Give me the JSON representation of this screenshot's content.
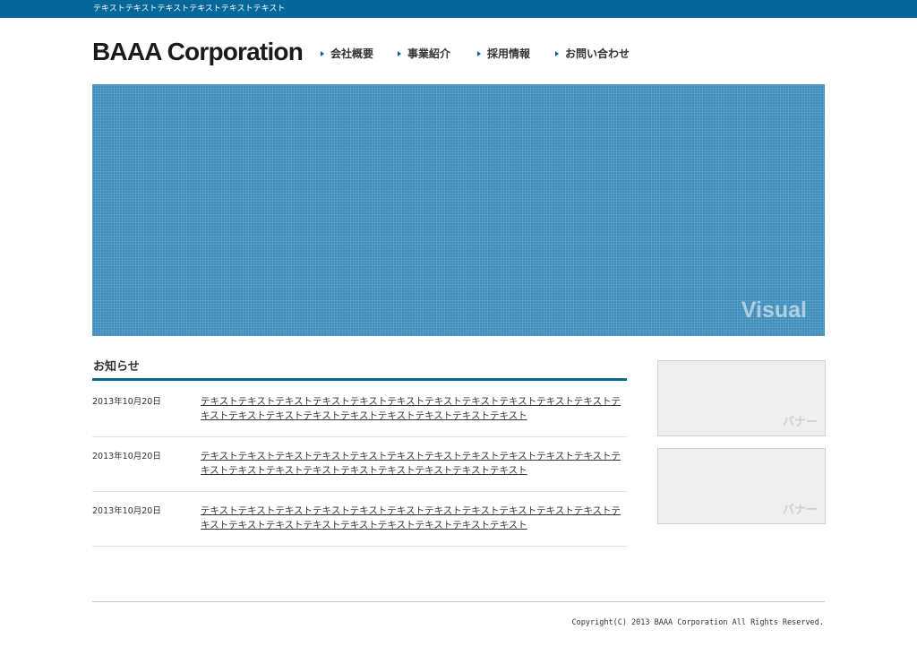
{
  "header": {
    "topbar_text": "テキストテキストテキストテキストテキストテキスト",
    "logo": "BAAA Corporation"
  },
  "nav": {
    "items": [
      {
        "label": "会社概要"
      },
      {
        "label": "事業紹介"
      },
      {
        "label": "採用情報"
      },
      {
        "label": "お問い合わせ"
      }
    ]
  },
  "visual": {
    "label": "Visual"
  },
  "news": {
    "heading": "お知らせ",
    "items": [
      {
        "date": "2013年10月20日",
        "text": "テキストテキストテキストテキストテキストテキストテキストテキストテキストテキストテキストテキストテキストテキストテキストテキストテキストテキストテキストテキスト"
      },
      {
        "date": "2013年10月20日",
        "text": "テキストテキストテキストテキストテキストテキストテキストテキストテキストテキストテキストテキストテキストテキストテキストテキストテキストテキストテキストテキスト"
      },
      {
        "date": "2013年10月20日",
        "text": "テキストテキストテキストテキストテキストテキストテキストテキストテキストテキストテキストテキストテキストテキストテキストテキストテキストテキストテキストテキスト"
      }
    ]
  },
  "sidebar": {
    "banners": [
      {
        "label": "バナー"
      },
      {
        "label": "バナー"
      }
    ]
  },
  "footer": {
    "copyright": "Copyright(C) 2013 BAAA Corporation All Rights Reserved."
  },
  "colors": {
    "brand": "#05679a",
    "visual": "#3e8dba",
    "banner_bg": "#efefef"
  },
  "icons": {
    "nav_marker": "triangle-right-icon"
  }
}
